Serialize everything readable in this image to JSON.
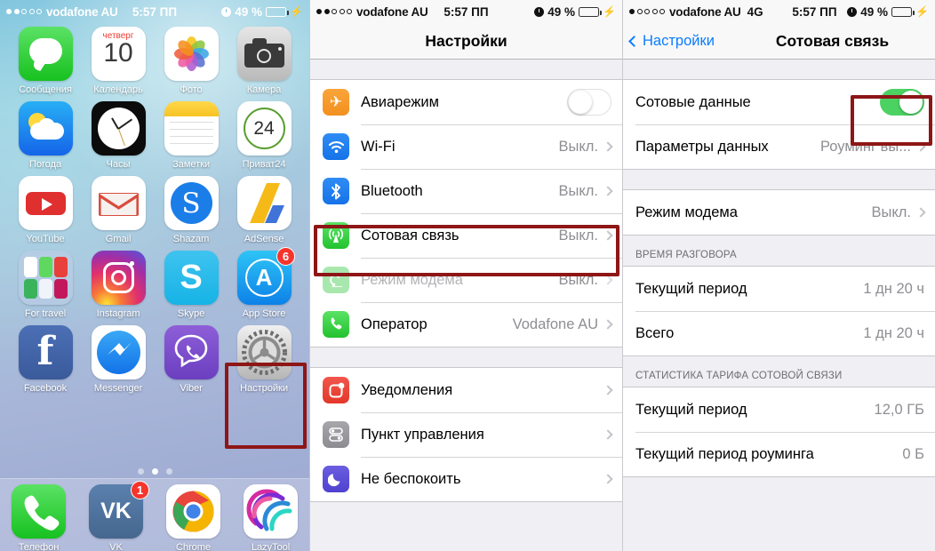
{
  "panel1": {
    "statusbar": {
      "signal_dots_filled": 2,
      "signal_dots_total": 5,
      "carrier": "vodafone AU",
      "network": "",
      "time": "5:57 ПП",
      "battery": "49 %",
      "battery_pct": 49
    },
    "apps": [
      {
        "label": "Сообщения",
        "icon": "messages-icon",
        "badge": ""
      },
      {
        "label": "Календарь",
        "icon": "calendar-icon",
        "badge": "",
        "weekday": "четверг",
        "day": "10"
      },
      {
        "label": "Фото",
        "icon": "photos-icon",
        "badge": ""
      },
      {
        "label": "Камера",
        "icon": "camera-icon",
        "badge": ""
      },
      {
        "label": "Погода",
        "icon": "weather-icon",
        "badge": ""
      },
      {
        "label": "Часы",
        "icon": "clock-icon",
        "badge": ""
      },
      {
        "label": "Заметки",
        "icon": "notes-icon",
        "badge": ""
      },
      {
        "label": "Приват24",
        "icon": "privat24-icon",
        "badge": "",
        "day": "24"
      },
      {
        "label": "YouTube",
        "icon": "youtube-icon",
        "badge": ""
      },
      {
        "label": "Gmail",
        "icon": "gmail-icon",
        "badge": ""
      },
      {
        "label": "Shazam",
        "icon": "shazam-icon",
        "badge": "",
        "glyph": "S"
      },
      {
        "label": "AdSense",
        "icon": "adsense-icon",
        "badge": ""
      },
      {
        "label": "For travel",
        "icon": "folder-icon",
        "badge": ""
      },
      {
        "label": "Instagram",
        "icon": "instagram-icon",
        "badge": ""
      },
      {
        "label": "Skype",
        "icon": "skype-icon",
        "badge": "",
        "glyph": "S"
      },
      {
        "label": "App Store",
        "icon": "appstore-icon",
        "badge": "6",
        "glyph": "A"
      },
      {
        "label": "Facebook",
        "icon": "facebook-icon",
        "badge": "",
        "glyph": "f"
      },
      {
        "label": "Messenger",
        "icon": "messenger-icon",
        "badge": ""
      },
      {
        "label": "Viber",
        "icon": "viber-icon",
        "badge": ""
      },
      {
        "label": "Настройки",
        "icon": "settings-gear-icon",
        "badge": ""
      }
    ],
    "dock": [
      {
        "label": "Телефон",
        "icon": "phone-icon",
        "badge": ""
      },
      {
        "label": "VK",
        "icon": "vk-icon",
        "badge": "1",
        "glyph": "VK"
      },
      {
        "label": "Chrome",
        "icon": "chrome-icon",
        "badge": ""
      },
      {
        "label": "LazyTool",
        "icon": "lazytool-icon",
        "badge": ""
      }
    ],
    "page_dots": {
      "count": 3,
      "active_index": 1
    },
    "highlight_color": "#8e1616"
  },
  "panel2": {
    "statusbar": {
      "signal_dots_filled": 2,
      "signal_dots_total": 5,
      "carrier": "vodafone AU",
      "network": "",
      "time": "5:57 ПП",
      "battery": "49 %",
      "battery_pct": 49
    },
    "nav": {
      "title": "Настройки"
    },
    "group1": [
      {
        "label": "Авиарежим",
        "icon": "airplane-icon",
        "control": "toggle",
        "toggle_on": false,
        "value": "",
        "chevron": false,
        "dim": false
      },
      {
        "label": "Wi-Fi",
        "icon": "wifi-icon",
        "control": "value",
        "value": "Выкл.",
        "chevron": true,
        "dim": false
      },
      {
        "label": "Bluetooth",
        "icon": "bluetooth-icon",
        "control": "value",
        "value": "Выкл.",
        "chevron": true,
        "dim": false
      },
      {
        "label": "Сотовая связь",
        "icon": "cellular-icon",
        "control": "value",
        "value": "Выкл.",
        "chevron": true,
        "dim": false,
        "highlighted": true
      },
      {
        "label": "Режим модема",
        "icon": "hotspot-icon",
        "control": "value",
        "value": "Выкл.",
        "chevron": true,
        "dim": true
      },
      {
        "label": "Оператор",
        "icon": "operator-icon",
        "control": "value",
        "value": "Vodafone AU",
        "chevron": true,
        "dim": false
      }
    ],
    "group2": [
      {
        "label": "Уведомления",
        "icon": "notifications-icon",
        "control": "chevron",
        "value": "",
        "chevron": true,
        "dim": false
      },
      {
        "label": "Пункт управления",
        "icon": "control-center-icon",
        "control": "chevron",
        "value": "",
        "chevron": true,
        "dim": false
      },
      {
        "label": "Не беспокоить",
        "icon": "do-not-disturb-icon",
        "control": "chevron",
        "value": "",
        "chevron": true,
        "dim": false
      }
    ]
  },
  "panel3": {
    "statusbar": {
      "signal_dots_filled": 1,
      "signal_dots_total": 5,
      "carrier": "vodafone AU",
      "network": "4G",
      "time": "5:57 ПП",
      "battery": "49 %",
      "battery_pct": 49
    },
    "nav": {
      "back_label": "Настройки",
      "title": "Сотовая связь"
    },
    "group1": [
      {
        "label": "Сотовые данные",
        "control": "toggle",
        "toggle_on": true,
        "value": "",
        "chevron": false,
        "highlighted": true
      },
      {
        "label": "Параметры данных",
        "control": "value",
        "value": "Роуминг вы...",
        "chevron": true
      }
    ],
    "group2": [
      {
        "label": "Режим модема",
        "control": "value",
        "value": "Выкл.",
        "chevron": true
      }
    ],
    "section_call": {
      "header": "ВРЕМЯ РАЗГОВОРА",
      "rows": [
        {
          "label": "Текущий период",
          "value": "1 дн 20 ч"
        },
        {
          "label": "Всего",
          "value": "1 дн 20 ч"
        }
      ]
    },
    "section_stats": {
      "header": "СТАТИСТИКА ТАРИФА СОТОВОЙ СВЯЗИ",
      "rows": [
        {
          "label": "Текущий период",
          "value": "12,0 ГБ"
        },
        {
          "label": "Текущий период роуминга",
          "value": "0 Б"
        }
      ]
    }
  }
}
